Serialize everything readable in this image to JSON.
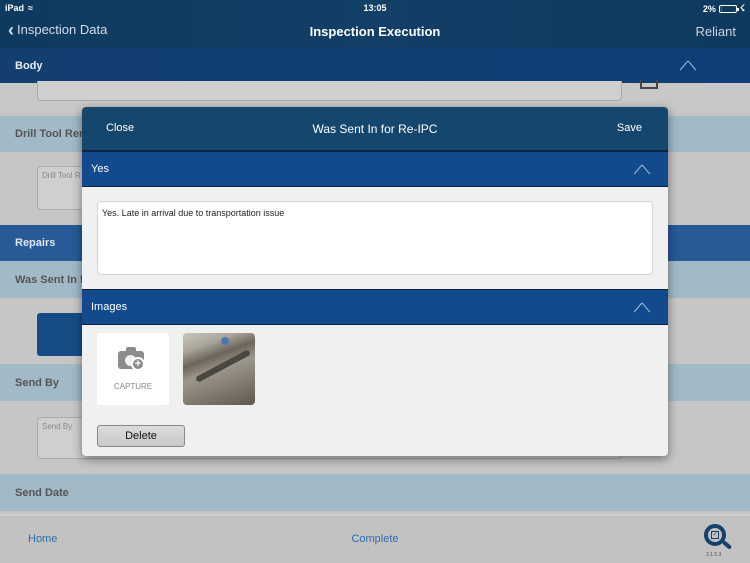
{
  "status_bar": {
    "device": "iPad",
    "time": "13:05",
    "battery": "2%"
  },
  "nav": {
    "back_label": "Inspection Data",
    "title": "Inspection Execution",
    "right_label": "Reliant"
  },
  "background": {
    "body_header": "Body",
    "drill_tool_label": "Drill Tool Rem",
    "drill_tool_placeholder": "Drill Tool R",
    "repairs_header": "Repairs",
    "was_sent_label": "Was Sent In f",
    "send_by_label": "Send By",
    "send_by_placeholder": "Send By",
    "send_date_label": "Send Date"
  },
  "modal": {
    "close_label": "Close",
    "title": "Was Sent In for Re-IPC",
    "save_label": "Save",
    "answer_header": "Yes",
    "answer_text": "Yes. Late in arrival due to transportation issue",
    "images_header": "Images",
    "capture_label": "CAPTURE",
    "delete_label": "Delete"
  },
  "bottom_bar": {
    "home_label": "Home",
    "complete_label": "Complete",
    "version": "3.1.5.3"
  },
  "colors": {
    "nav_bg": "#123f66",
    "section_header": "#124a8c",
    "link": "#2a6db2"
  }
}
